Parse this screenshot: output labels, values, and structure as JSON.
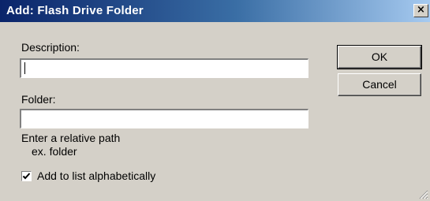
{
  "window": {
    "title": "Add:  Flash Drive Folder",
    "close_glyph": "×"
  },
  "form": {
    "description_label": "Description:",
    "description_value": "",
    "folder_label": "Folder:",
    "folder_value": "",
    "hint_line1": "Enter a relative path",
    "hint_line2": "ex. folder",
    "checkbox_label": "Add to list alphabetically",
    "checkbox_checked": true
  },
  "buttons": {
    "ok_label": "OK",
    "cancel_label": "Cancel"
  },
  "icons": {
    "close": "close-icon",
    "checkmark": "checkmark-icon",
    "resize_grip": "resize-grip-icon"
  }
}
